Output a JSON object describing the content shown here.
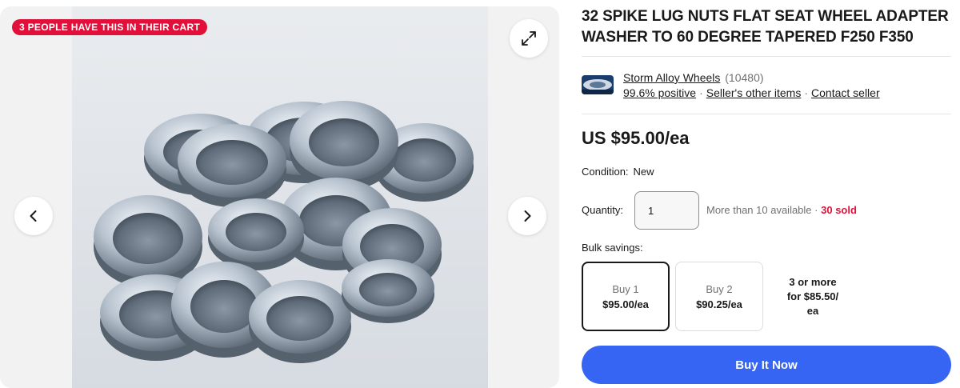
{
  "gallery": {
    "cart_badge": "3 PEOPLE HAVE THIS IN THEIR CART",
    "expand_icon": "expand-icon",
    "prev_icon": "chevron-left-icon",
    "next_icon": "chevron-right-icon"
  },
  "listing": {
    "title": "32 SPIKE LUG NUTS FLAT SEAT WHEEL ADAPTER WASHER TO 60 DEGREE TAPERED F250 F350"
  },
  "seller": {
    "name": "Storm Alloy Wheels",
    "feedback_count": "(10480)",
    "positive": "99.6% positive",
    "other_items": "Seller's other items",
    "contact": "Contact seller",
    "separator": "·"
  },
  "price": {
    "display": "US $95.00/ea"
  },
  "condition": {
    "label": "Condition:",
    "value": "New"
  },
  "quantity": {
    "label": "Quantity:",
    "value": "1",
    "availability": "More than 10 available",
    "separator": "·",
    "sold": "30 sold"
  },
  "bulk": {
    "label": "Bulk savings:",
    "tiers": [
      {
        "line1": "Buy 1",
        "line2": "$95.00/ea"
      },
      {
        "line1": "Buy 2",
        "line2": "$90.25/ea"
      },
      {
        "text": "3 or more\nfor $85.50/\nea"
      }
    ]
  },
  "actions": {
    "buy_now": "Buy It Now"
  },
  "colors": {
    "accent_blue": "#3665f3",
    "badge_red": "#e0103a",
    "sold_red": "#e0103a"
  }
}
